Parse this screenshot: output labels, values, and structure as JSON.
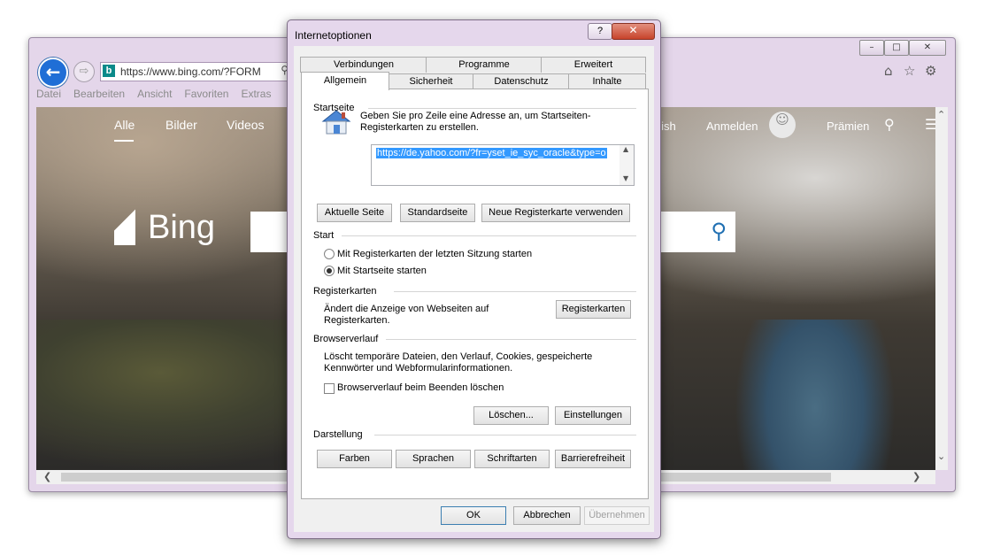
{
  "browser": {
    "address_url": "https://www.bing.com/?FORM",
    "back_icon": "back-arrow-icon",
    "menu": [
      "Datei",
      "Bearbeiten",
      "Ansicht",
      "Favoriten",
      "Extras"
    ],
    "window_buttons": {
      "minimize": "–",
      "maximize": "□",
      "close": "✕"
    },
    "bing": {
      "nav": [
        "Alle",
        "Bilder",
        "Videos"
      ],
      "logo_text": "Bing",
      "right_language": "glish",
      "sign_in": "Anmelden",
      "rewards": "Prämien"
    }
  },
  "dialog": {
    "title": "Internetoptionen",
    "help_label": "?",
    "close_label": "✕",
    "tabs_row1": [
      "Verbindungen",
      "Programme",
      "Erweitert"
    ],
    "tabs_row2": [
      "Allgemein",
      "Sicherheit",
      "Datenschutz",
      "Inhalte"
    ],
    "selected_tab": "Allgemein",
    "startseite": {
      "heading": "Startseite",
      "description_line1": "Geben Sie pro Zeile eine Adresse an, um Startseiten-",
      "description_line2": "Registerkarten zu erstellen.",
      "url_value": "https://de.yahoo.com/?fr=yset_ie_syc_oracle&type=o",
      "buttons": [
        "Aktuelle Seite",
        "Standardseite",
        "Neue Registerkarte verwenden"
      ]
    },
    "start": {
      "heading": "Start",
      "option1": "Mit Registerkarten der letzten Sitzung starten",
      "option2": "Mit Startseite starten",
      "selected": "option2"
    },
    "registerkarten": {
      "heading": "Registerkarten",
      "description_line1": "Ändert die Anzeige von Webseiten auf",
      "description_line2": "Registerkarten.",
      "button": "Registerkarten"
    },
    "browserverlauf": {
      "heading": "Browserverlauf",
      "description_line1": "Löscht temporäre Dateien, den Verlauf, Cookies, gespeicherte",
      "description_line2": "Kennwörter und Webformularinformationen.",
      "checkbox_label": "Browserverlauf beim Beenden löschen",
      "checkbox_checked": false,
      "delete_button": "Löschen...",
      "settings_button": "Einstellungen"
    },
    "darstellung": {
      "heading": "Darstellung",
      "buttons": [
        "Farben",
        "Sprachen",
        "Schriftarten",
        "Barrierefreiheit"
      ]
    },
    "footer": {
      "ok": "OK",
      "cancel": "Abbrechen",
      "apply": "Übernehmen"
    }
  }
}
